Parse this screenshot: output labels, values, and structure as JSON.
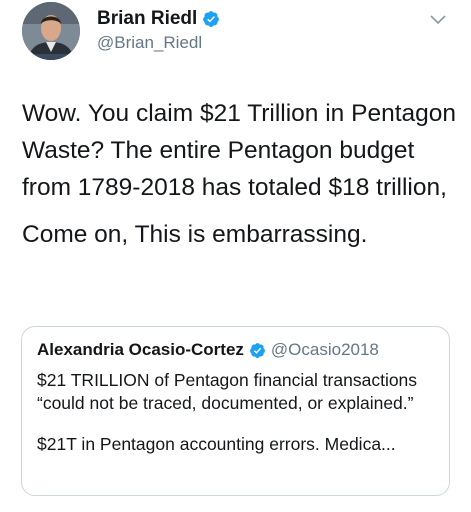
{
  "tweet": {
    "display_name": "Brian Riedl",
    "handle": "@Brian_Riedl",
    "avatar_icon": "person-photo-avatar",
    "verified_icon": "verified-badge-icon",
    "menu_icon": "chevron-down-icon",
    "text_paragraphs": [
      "Wow.  You claim $21 Trillion in Pentagon Waste?   The entire Pentagon budget from 1789-2018 has totaled $18 trillion,",
      "Come on,  This is embarrassing."
    ]
  },
  "quoted_tweet": {
    "display_name": "Alexandria Ocasio-Cortez",
    "handle": "@Ocasio2018",
    "verified_icon": "verified-badge-icon",
    "text_paragraphs": [
      "$21 TRILLION of Pentagon financial transactions “could not be traced, documented, or explained.”",
      "$21T in Pentagon accounting errors. Medica..."
    ]
  },
  "colors": {
    "verified": "#1da1f2",
    "secondary_text": "#657786",
    "border": "#ccd6dd",
    "primary_text": "#14171a"
  }
}
